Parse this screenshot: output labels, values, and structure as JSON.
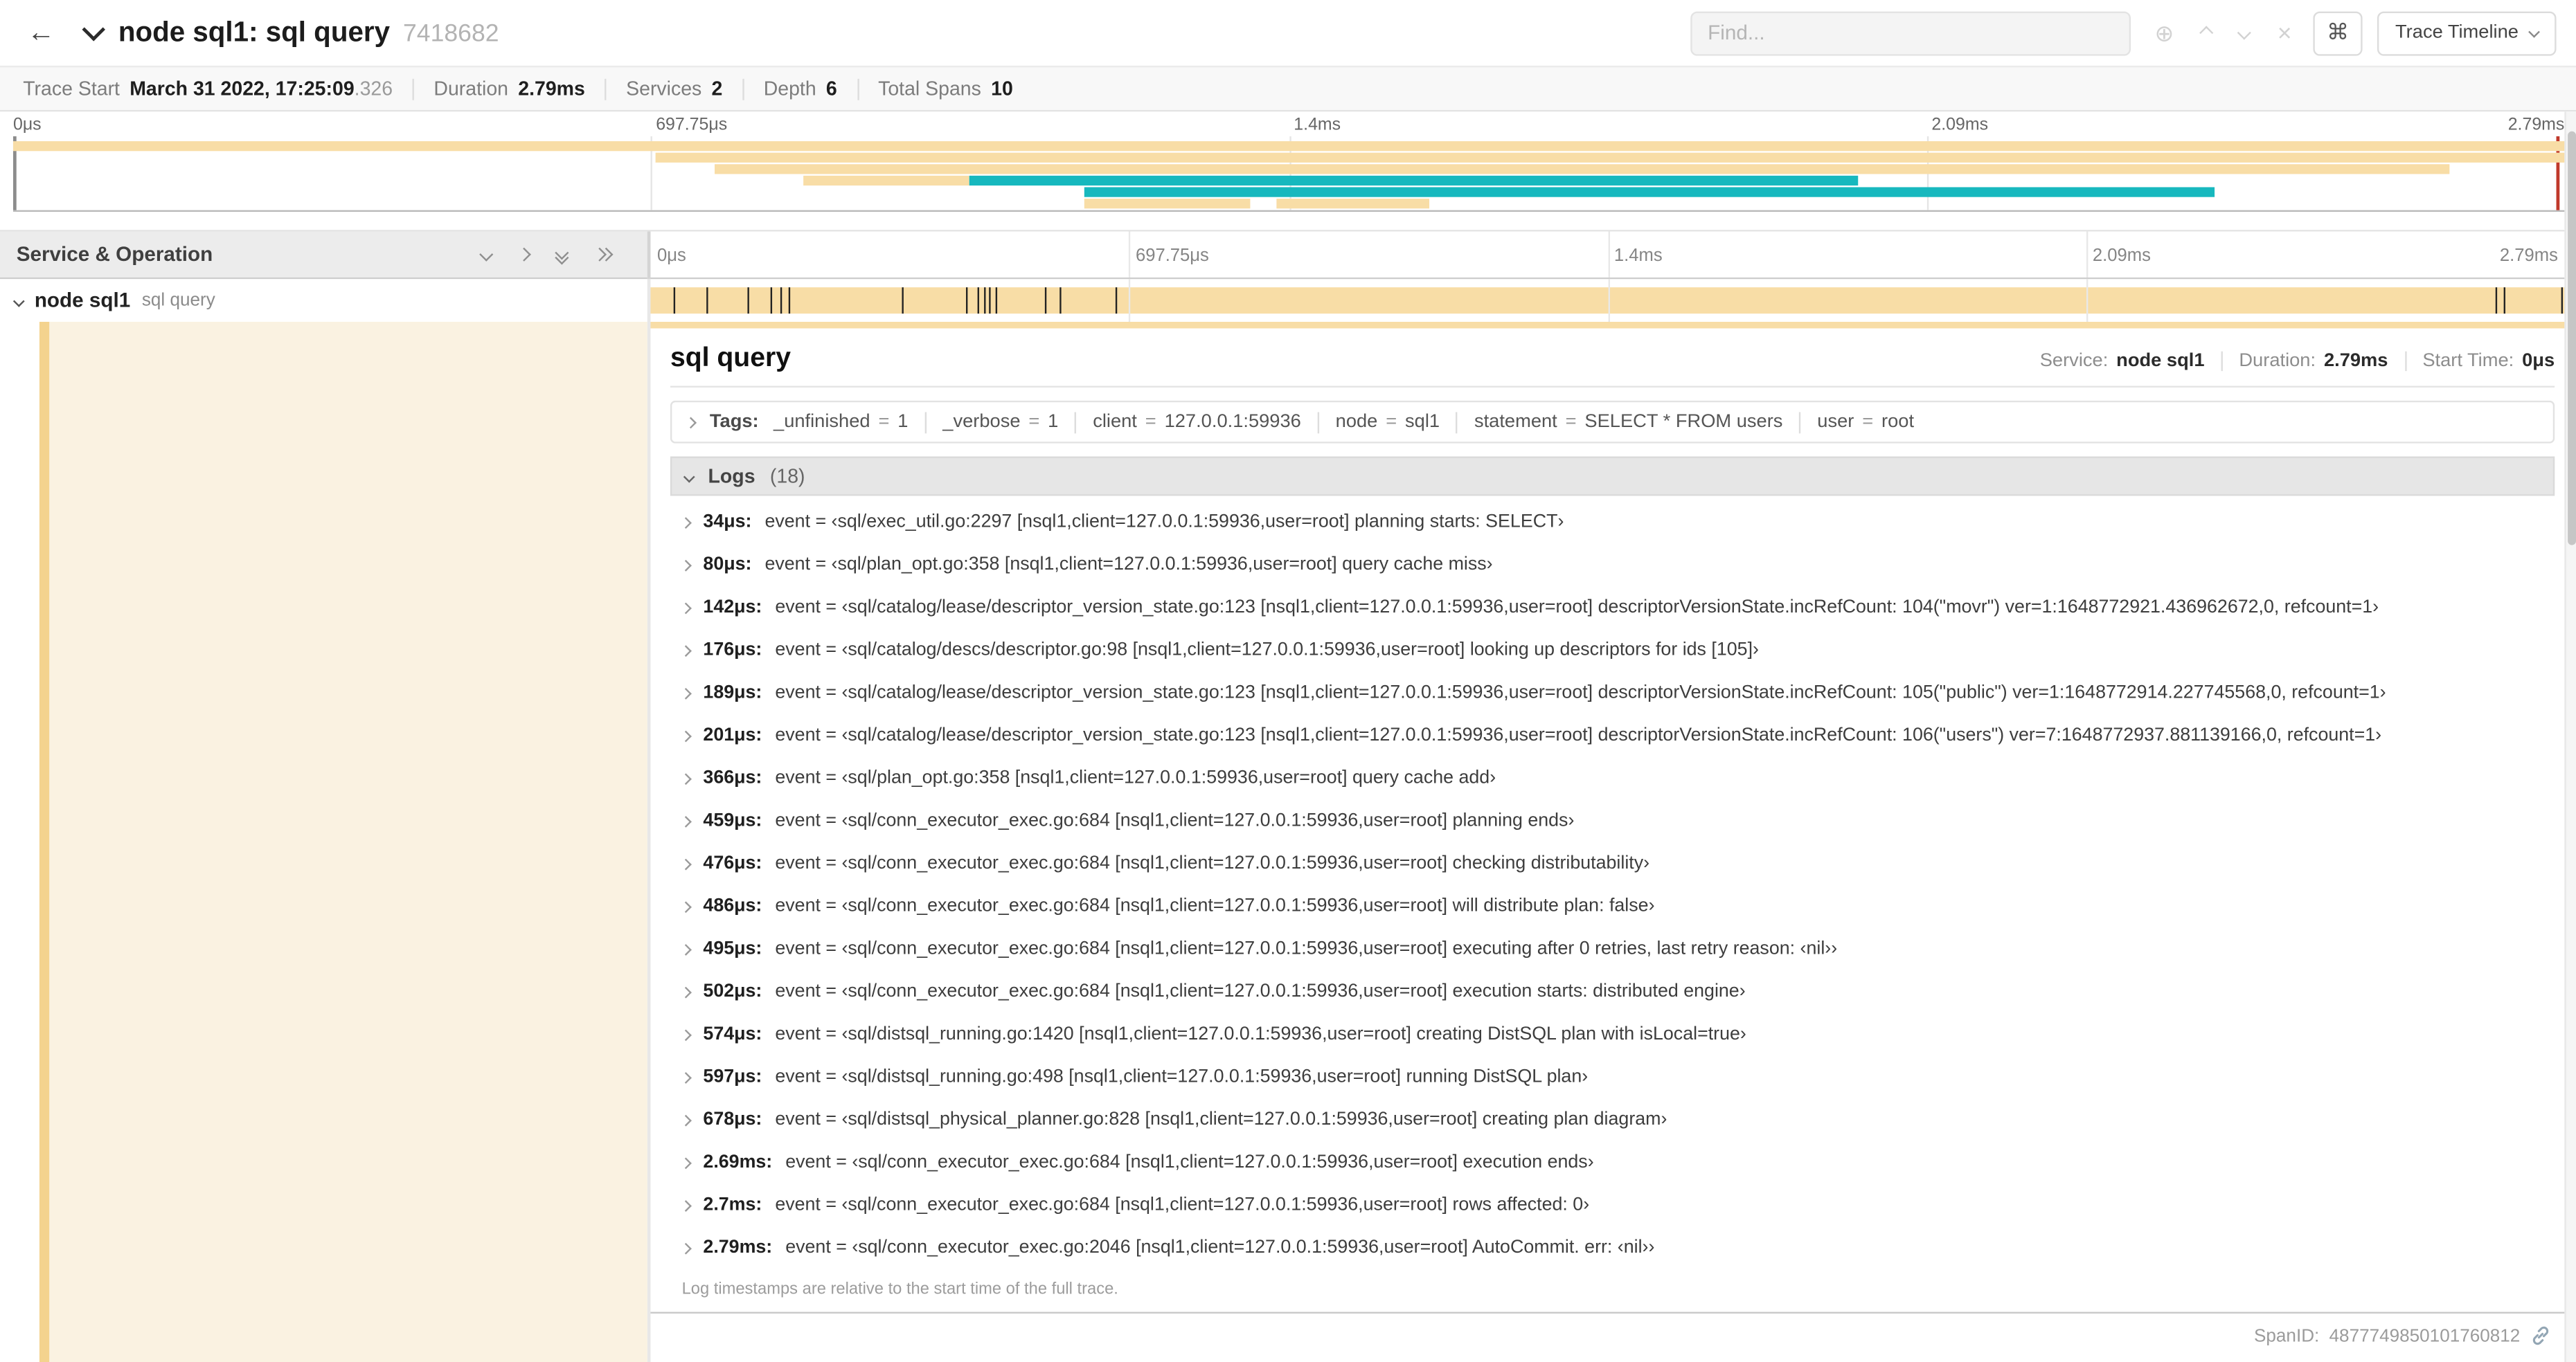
{
  "colors": {
    "tan": "#F8DDA6",
    "teal": "#17B8BE",
    "row_tint": "#FAF2E1",
    "row_strip": "#F4D38E",
    "accent_red": "#c0392b"
  },
  "header": {
    "back_label": "←",
    "title": "node sql1: sql query",
    "trace_id": "7418682",
    "find_placeholder": "Find...",
    "icons": {
      "focus": "⊕",
      "clear": "×"
    },
    "shortcut_label": "⌘",
    "view_select_label": "Trace Timeline"
  },
  "summary": [
    {
      "label": "Trace Start",
      "value": "March 31 2022, 17:25:09",
      "suffix": ".326"
    },
    {
      "label": "Duration",
      "value": "2.79ms",
      "suffix": ""
    },
    {
      "label": "Services",
      "value": "2",
      "suffix": ""
    },
    {
      "label": "Depth",
      "value": "6",
      "suffix": ""
    },
    {
      "label": "Total Spans",
      "value": "10",
      "suffix": ""
    }
  ],
  "minimap": {
    "ticks": [
      {
        "label": "0μs",
        "pct": 0
      },
      {
        "label": "697.75μs",
        "pct": 25
      },
      {
        "label": "1.4ms",
        "pct": 50
      },
      {
        "label": "2.09ms",
        "pct": 75
      },
      {
        "label": "2.79ms",
        "pct": 100
      }
    ],
    "bars": [
      {
        "row": 0,
        "start": 0,
        "end": 100,
        "color": "tan"
      },
      {
        "row": 1,
        "start": 25.2,
        "end": 100,
        "color": "tan"
      },
      {
        "row": 2,
        "start": 27.5,
        "end": 95.5,
        "color": "tan"
      },
      {
        "row": 3,
        "start": 31,
        "end": 37.5,
        "color": "tan"
      },
      {
        "row": 3,
        "start": 37.5,
        "end": 72.3,
        "color": "teal"
      },
      {
        "row": 4,
        "start": 42,
        "end": 86.3,
        "color": "teal"
      },
      {
        "row": 5,
        "start": 42,
        "end": 48.5,
        "color": "tan"
      },
      {
        "row": 5,
        "start": 49.5,
        "end": 55.5,
        "color": "tan"
      }
    ]
  },
  "timeline": {
    "left_header": "Service & Operation",
    "ruler_ticks": [
      {
        "label": "0μs",
        "pct": 0
      },
      {
        "label": "697.75μs",
        "pct": 25
      },
      {
        "label": "1.4ms",
        "pct": 50
      },
      {
        "label": "2.09ms",
        "pct": 75
      },
      {
        "label": "2.79ms",
        "pct": 100
      }
    ],
    "span": {
      "service": "node sql1",
      "operation": "sql query"
    },
    "event_marks_pct": [
      1.2,
      2.9,
      5.1,
      6.3,
      6.8,
      7.2,
      13.1,
      16.5,
      17.1,
      17.4,
      17.7,
      18.0,
      20.6,
      21.4,
      24.3,
      96.4,
      96.8,
      99.8
    ]
  },
  "detail": {
    "title": "sql query",
    "meta": [
      {
        "label": "Service:",
        "value": "node sql1"
      },
      {
        "label": "Duration:",
        "value": "2.79ms"
      },
      {
        "label": "Start Time:",
        "value": "0μs"
      }
    ],
    "tags_label": "Tags:",
    "eq": "=",
    "tags": [
      {
        "key": "_unfinished",
        "value": "1"
      },
      {
        "key": "_verbose",
        "value": "1"
      },
      {
        "key": "client",
        "value": "127.0.0.1:59936"
      },
      {
        "key": "node",
        "value": "sql1"
      },
      {
        "key": "statement",
        "value": "SELECT * FROM users"
      },
      {
        "key": "user",
        "value": "root"
      }
    ],
    "logs_label": "Logs",
    "logs_count": "(18)",
    "logs": [
      {
        "time": "34μs:",
        "message": "event = ‹sql/exec_util.go:2297 [nsql1,client=127.0.0.1:59936,user=root] planning starts: SELECT›"
      },
      {
        "time": "80μs:",
        "message": "event = ‹sql/plan_opt.go:358 [nsql1,client=127.0.0.1:59936,user=root] query cache miss›"
      },
      {
        "time": "142μs:",
        "message": "event = ‹sql/catalog/lease/descriptor_version_state.go:123 [nsql1,client=127.0.0.1:59936,user=root] descriptorVersionState.incRefCount: 104(\"movr\") ver=1:1648772921.436962672,0, refcount=1›"
      },
      {
        "time": "176μs:",
        "message": "event = ‹sql/catalog/descs/descriptor.go:98 [nsql1,client=127.0.0.1:59936,user=root] looking up descriptors for ids [105]›"
      },
      {
        "time": "189μs:",
        "message": "event = ‹sql/catalog/lease/descriptor_version_state.go:123 [nsql1,client=127.0.0.1:59936,user=root] descriptorVersionState.incRefCount: 105(\"public\") ver=1:1648772914.227745568,0, refcount=1›"
      },
      {
        "time": "201μs:",
        "message": "event = ‹sql/catalog/lease/descriptor_version_state.go:123 [nsql1,client=127.0.0.1:59936,user=root] descriptorVersionState.incRefCount: 106(\"users\") ver=7:1648772937.881139166,0, refcount=1›"
      },
      {
        "time": "366μs:",
        "message": "event = ‹sql/plan_opt.go:358 [nsql1,client=127.0.0.1:59936,user=root] query cache add›"
      },
      {
        "time": "459μs:",
        "message": "event = ‹sql/conn_executor_exec.go:684 [nsql1,client=127.0.0.1:59936,user=root] planning ends›"
      },
      {
        "time": "476μs:",
        "message": "event = ‹sql/conn_executor_exec.go:684 [nsql1,client=127.0.0.1:59936,user=root] checking distributability›"
      },
      {
        "time": "486μs:",
        "message": "event = ‹sql/conn_executor_exec.go:684 [nsql1,client=127.0.0.1:59936,user=root] will distribute plan: false›"
      },
      {
        "time": "495μs:",
        "message": "event = ‹sql/conn_executor_exec.go:684 [nsql1,client=127.0.0.1:59936,user=root] executing after 0 retries, last retry reason: ‹nil››"
      },
      {
        "time": "502μs:",
        "message": "event = ‹sql/conn_executor_exec.go:684 [nsql1,client=127.0.0.1:59936,user=root] execution starts: distributed engine›"
      },
      {
        "time": "574μs:",
        "message": "event = ‹sql/distsql_running.go:1420 [nsql1,client=127.0.0.1:59936,user=root] creating DistSQL plan with isLocal=true›"
      },
      {
        "time": "597μs:",
        "message": "event = ‹sql/distsql_running.go:498 [nsql1,client=127.0.0.1:59936,user=root] running DistSQL plan›"
      },
      {
        "time": "678μs:",
        "message": "event = ‹sql/distsql_physical_planner.go:828 [nsql1,client=127.0.0.1:59936,user=root] creating plan diagram›"
      },
      {
        "time": "2.69ms:",
        "message": "event = ‹sql/conn_executor_exec.go:684 [nsql1,client=127.0.0.1:59936,user=root] execution ends›"
      },
      {
        "time": "2.7ms:",
        "message": "event = ‹sql/conn_executor_exec.go:684 [nsql1,client=127.0.0.1:59936,user=root] rows affected: 0›"
      },
      {
        "time": "2.79ms:",
        "message": "event = ‹sql/conn_executor_exec.go:2046 [nsql1,client=127.0.0.1:59936,user=root] AutoCommit. err: ‹nil››"
      }
    ],
    "logs_note": "Log timestamps are relative to the start time of the full trace.",
    "span_id_label": "SpanID:",
    "span_id": "4877749850101760812"
  }
}
